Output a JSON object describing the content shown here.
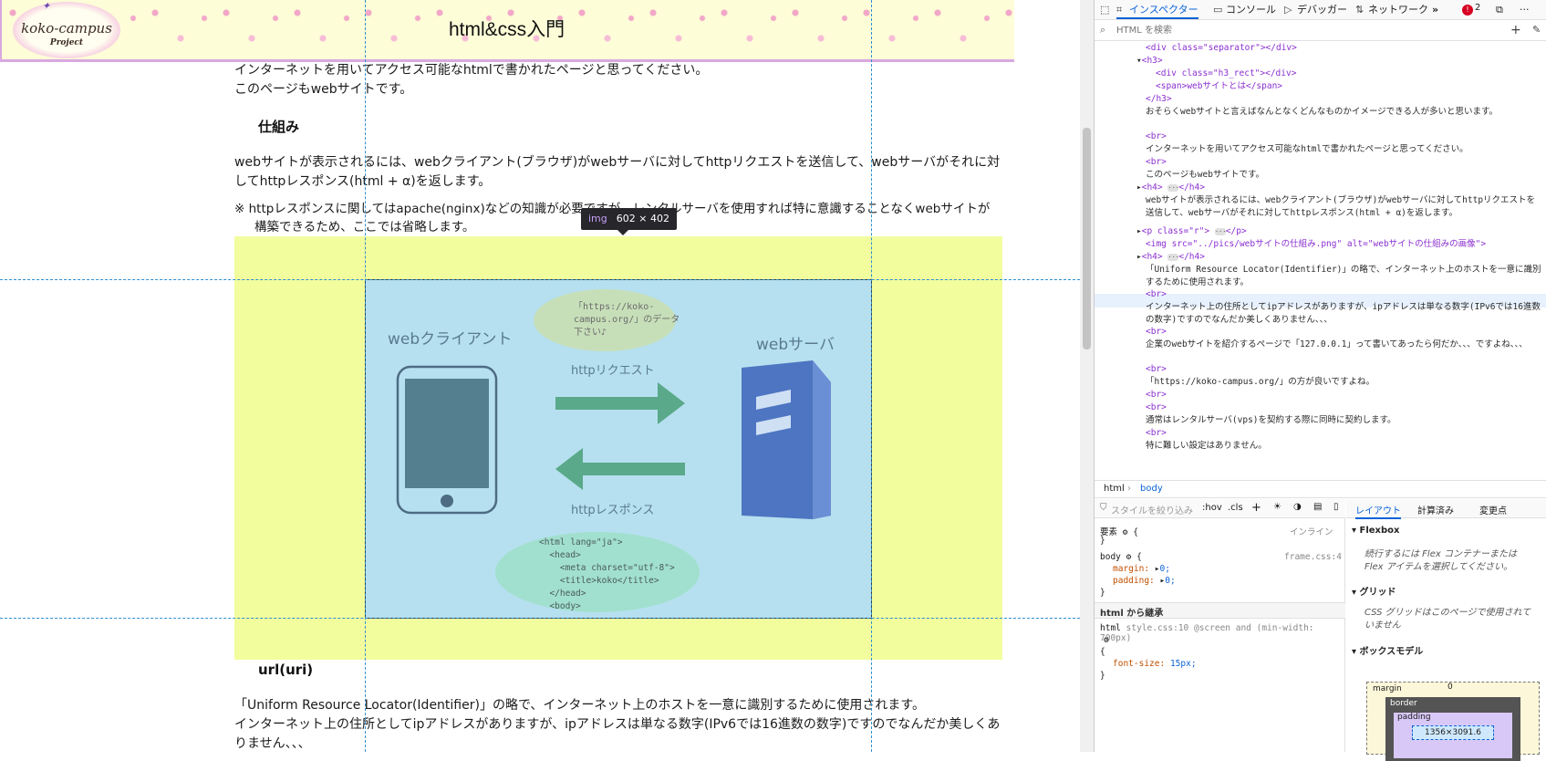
{
  "page": {
    "header": {
      "title": "html&css入門",
      "logo_line1": "koko-campus",
      "logo_line2": "Project"
    },
    "para_top_1": "インターネットを用いてアクセス可能なhtmlで書かれたページと思ってください。",
    "para_top_2": "このページもwebサイトです。",
    "heading_mechanism": "仕組み",
    "para_mech_1": "webサイトが表示されるには、webクライアント(ブラウザ)がwebサーバに対してhttpリクエストを送信して、webサーバがそれに対",
    "para_mech_2": "してhttpレスポンス(html + α)を返します。",
    "note_1": "※ httpレスポンスに関してはapache(nginx)などの知識が必要ですが、レンタルサーバを使用すれば特に意識することなくwebサイトが",
    "note_2": "構築できるため、ここでは省略します。",
    "diagram": {
      "client_label": "webクライアント",
      "server_label": "webサーバ",
      "request_label": "httpリクエスト",
      "response_label": "httpレスポンス",
      "bubble_request": [
        "「https://koko-",
        "campus.org/」のデータ",
        "下さい♪"
      ],
      "bubble_response": [
        "<html lang=\"ja\">",
        "  <head>",
        "    <meta charset=\"utf-8\">",
        "    <title>koko</title>",
        "  </head>",
        "  <body>"
      ]
    },
    "heading_url": "url(uri)",
    "para_url_1": "「Uniform Resource Locator(Identifier)」の略で、インターネット上のホストを一意に識別するために使用されます。",
    "para_url_2": "インターネット上の住所としてipアドレスがありますが、ipアドレスは単なる数字(IPv6では16進数の数字)ですのでなんだか美しくあ",
    "para_url_3": "りません、、、",
    "tooltip_tag": "img",
    "tooltip_size": "602 × 402"
  },
  "devtools": {
    "toolbar": {
      "inspector": "インスペクター",
      "console": "コンソール",
      "debugger": "デバッガー",
      "network": "ネットワーク",
      "more": "»",
      "error_count": "2",
      "overflow": "···"
    },
    "search_placeholder": "HTML を検索",
    "tree": {
      "separator_div": "<div class=\"separator\"></div>",
      "h3_open": "<h3>",
      "h3_rect": "<div class=\"h3_rect\"></div>",
      "h3_span": "<span>webサイトとは</span>",
      "h3_close": "</h3>",
      "t1": "おそらくwebサイトと言えばなんとなくどんなものかイメージできる人が多いと思います。",
      "br": "<br>",
      "t2": "インターネットを用いてアクセス可能なhtmlで書かれたページと思ってください。",
      "t3": "このページもwebサイトです。",
      "h4_a": "<h4>",
      "h4_a_close": "</h4>",
      "t4": "webサイトが表示されるには、webクライアント(ブラウザ)がwebサーバに対してhttpリクエストを送信して、webサーバがそれに対してhttpレスポンス(html + α)を返します。",
      "p_r": "<p class=\"r\">",
      "p_close": "</p>",
      "img_tag": "<img src=\"../pics/webサイトの仕組み.png\" alt=\"webサイトの仕組みの画像\">",
      "t5": "「Uniform Resource Locator(Identifier)」の略で、インターネット上のホストを一意に識別するために使用されます。",
      "t6": "インターネット上の住所としてipアドレスがありますが、ipアドレスは単なる数字(IPv6では16進数の数字)ですのでなんだか美しくありません、、、",
      "t7": "企業のwebサイトを紹介するページで「127.0.0.1」って書いてあったら何だか、、、ですよね、、、",
      "t8": "「https://koko-campus.org/」の方が良いですよね。",
      "t9": "通常はレンタルサーバ(vps)を契約する際に同時に契約します。",
      "t10": "特に難しい設定はありません。"
    },
    "breadcrumb": [
      "html",
      "body"
    ],
    "rules": {
      "filter_placeholder": "スタイルを絞り込み",
      "hov": ":hov",
      "cls": ".cls",
      "element_label": "要素",
      "inline_label": "インライン",
      "body_selector": "body",
      "body_source": "frame.css:4",
      "margin_decl": "margin:",
      "margin_val": "0;",
      "padding_decl": "padding:",
      "padding_val": "0;",
      "inherited_label": "html から継承",
      "html_selector": "html",
      "html_source": "style.css:10 @screen and (min-width: 700px)",
      "font_decl": "font-size:",
      "font_val": "15px;"
    },
    "layout": {
      "tab_layout": "レイアウト",
      "tab_computed": "計算済み",
      "tab_changes": "変更点",
      "flexbox": "Flexbox",
      "flexbox_note": "続行するには Flex コンテナーまたは Flex アイテムを選択してください。",
      "grid": "グリッド",
      "grid_note": "CSS グリッドはこのページで使用されていません",
      "boxmodel": "ボックスモデル",
      "bm_margin": "margin",
      "bm_border": "border",
      "bm_padding": "padding",
      "bm_zero": "0",
      "bm_size": "1356×3091.6"
    }
  },
  "colors": {
    "accent": "#0a62d6",
    "highlight_box": "#f2fd9e",
    "image_bg": "#b6e0ef",
    "guide": "#2e8fd0"
  }
}
